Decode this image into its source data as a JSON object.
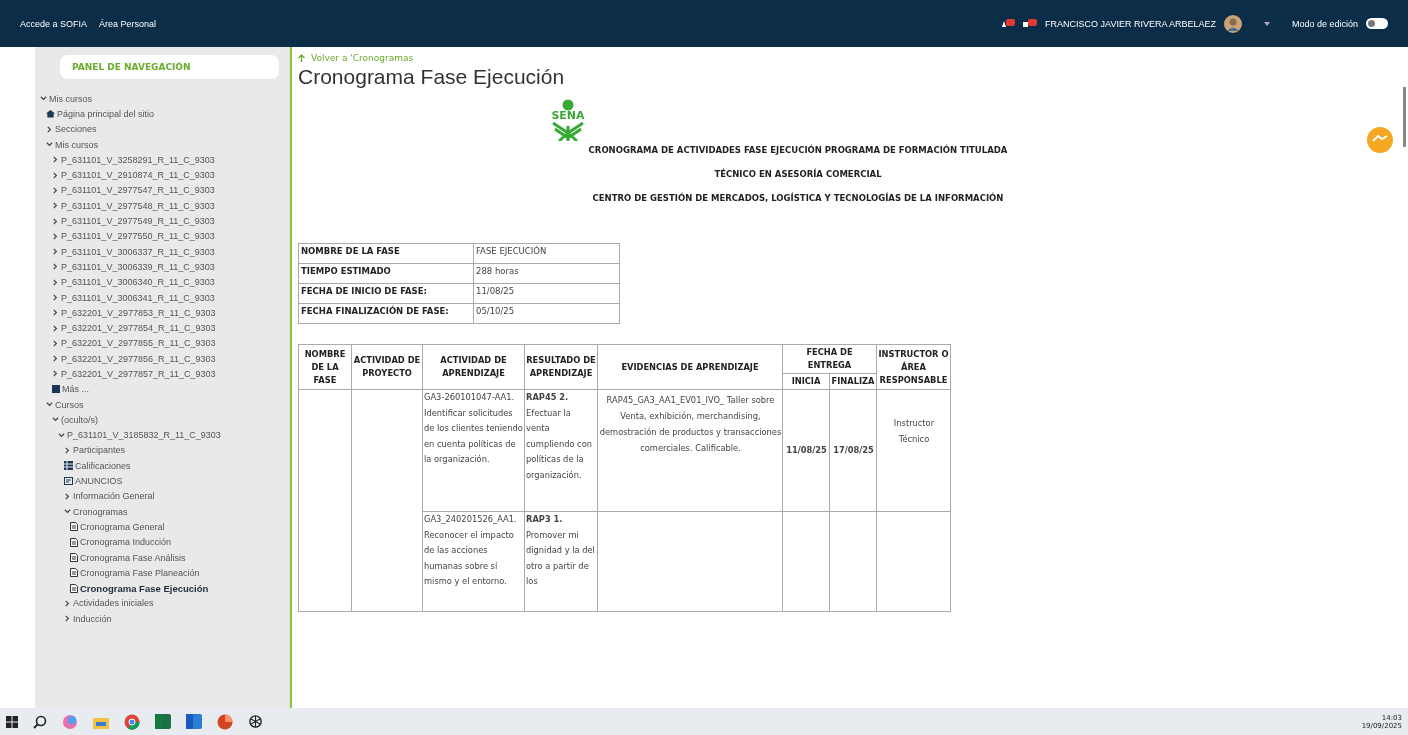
{
  "header": {
    "links": [
      "Accede a SOFIA",
      "Área Personal"
    ],
    "user_name": "FRANCISCO JAVIER RIVERA ARBELAEZ",
    "edit_mode": {
      "label": "Modo de edición",
      "on": false
    }
  },
  "sidebar": {
    "title": "PANEL DE NAVEGACIÓN",
    "items": [
      {
        "kind": "branch",
        "label": "Mis cursos",
        "expanded": true,
        "selected": false,
        "children": [
          {
            "kind": "home",
            "label": "Página principal del sitio",
            "selected": false
          },
          {
            "kind": "branch",
            "label": "Secciones",
            "expanded": false,
            "selected": false
          },
          {
            "kind": "branch",
            "label": "Mis cursos",
            "expanded": true,
            "selected": false,
            "children": [
              {
                "kind": "branch",
                "label": "P_631101_V_3258291_R_11_C_9303",
                "expanded": false,
                "selected": false
              },
              {
                "kind": "branch",
                "label": "P_631101_V_2910874_R_11_C_9303",
                "expanded": false,
                "selected": false
              },
              {
                "kind": "branch",
                "label": "P_631101_V_2977547_R_11_C_9303",
                "expanded": false,
                "selected": false
              },
              {
                "kind": "branch",
                "label": "P_631101_V_2977548_R_11_C_9303",
                "expanded": false,
                "selected": false
              },
              {
                "kind": "branch",
                "label": "P_631101_V_2977549_R_11_C_9303",
                "expanded": false,
                "selected": false
              },
              {
                "kind": "branch",
                "label": "P_631101_V_2977550_R_11_C_9303",
                "expanded": false,
                "selected": false
              },
              {
                "kind": "branch",
                "label": "P_631101_V_3006337_R_11_C_9303",
                "expanded": false,
                "selected": false
              },
              {
                "kind": "branch",
                "label": "P_631101_V_3006339_R_11_C_9303",
                "expanded": false,
                "selected": false
              },
              {
                "kind": "branch",
                "label": "P_631101_V_3006340_R_11_C_9303",
                "expanded": false,
                "selected": false
              },
              {
                "kind": "branch",
                "label": "P_631101_V_3006341_R_11_C_9303",
                "expanded": false,
                "selected": false
              },
              {
                "kind": "branch",
                "label": "P_632201_V_2977853_R_11_C_9303",
                "expanded": false,
                "selected": false
              },
              {
                "kind": "branch",
                "label": "P_632201_V_2977854_R_11_C_9303",
                "expanded": false,
                "selected": false
              },
              {
                "kind": "branch",
                "label": "P_632201_V_2977855_R_11_C_9303",
                "expanded": false,
                "selected": false
              },
              {
                "kind": "branch",
                "label": "P_632201_V_2977856_R_11_C_9303",
                "expanded": false,
                "selected": false
              },
              {
                "kind": "branch",
                "label": "P_632201_V_2977857_R_11_C_9303",
                "expanded": false,
                "selected": false
              },
              {
                "kind": "more",
                "label": "Más ...",
                "selected": false
              }
            ]
          },
          {
            "kind": "branch",
            "label": "Cursos",
            "expanded": true,
            "selected": false,
            "children": [
              {
                "kind": "branch",
                "label": "(oculto/s)",
                "expanded": true,
                "selected": false,
                "children": [
                  {
                    "kind": "branch",
                    "label": "P_631101_V_3185832_R_11_C_9303",
                    "expanded": true,
                    "selected": false,
                    "children": [
                      {
                        "kind": "branch",
                        "label": "Participantes",
                        "expanded": false,
                        "selected": false
                      },
                      {
                        "kind": "grades",
                        "label": "Calificaciones",
                        "selected": false
                      },
                      {
                        "kind": "forum",
                        "label": "ANUNCIOS",
                        "selected": false
                      },
                      {
                        "kind": "branch",
                        "label": "Información General",
                        "expanded": false,
                        "selected": false
                      },
                      {
                        "kind": "branch",
                        "label": "Cronogramas",
                        "expanded": true,
                        "selected": false,
                        "children": [
                          {
                            "kind": "file",
                            "label": "Cronograma General",
                            "selected": false
                          },
                          {
                            "kind": "file",
                            "label": "Cronograma Inducción",
                            "selected": false
                          },
                          {
                            "kind": "file",
                            "label": "Cronograma Fase Análisis",
                            "selected": false
                          },
                          {
                            "kind": "file",
                            "label": "Cronograma Fase Planeación",
                            "selected": false
                          },
                          {
                            "kind": "file",
                            "label": "Cronograma Fase Ejecución",
                            "selected": true
                          }
                        ]
                      },
                      {
                        "kind": "branch",
                        "label": "Actividades iniciales",
                        "expanded": false,
                        "selected": false
                      },
                      {
                        "kind": "branch",
                        "label": "Inducción",
                        "expanded": false,
                        "selected": false
                      }
                    ]
                  }
                ]
              }
            ]
          }
        ]
      }
    ]
  },
  "page": {
    "back_link": "Volver a 'Cronogramas",
    "title": "Cronograma Fase Ejecución",
    "logo_text": "SENA",
    "headings": [
      "CRONOGRAMA  DE ACTIVIDADES FASE EJECUCIÓN PROGRAMA DE FORMACIÓN TITULADA",
      "TÉCNICO EN ASESORÍA COMERCIAL",
      "CENTRO DE GESTIÓN DE MERCADOS, LOGÍSTICA Y TECNOLOGÍAS DE LA INFORMACIÓN"
    ],
    "info_table": [
      {
        "label": "NOMBRE DE LA FASE",
        "value": "FASE EJECUCIÓN"
      },
      {
        "label": "TIEMPO ESTIMADO",
        "value": "288 horas"
      },
      {
        "label": "FECHA DE INICIO DE FASE:",
        "value": "11/08/25"
      },
      {
        "label": "FECHA FINALIZACIÓN DE FASE:",
        "value": "05/10/25"
      }
    ],
    "table": {
      "columns": [
        "NOMBRE DE LA FASE",
        "ACTIVIDAD DE PROYECTO",
        "ACTIVIDAD DE APRENDIZAJE",
        "RESULTADO DE APRENDIZAJE",
        "EVIDENCIAS DE APRENDIZAJE",
        "FECHA DE ENTREGA",
        "INSTRUCTOR O ÁREA RESPONSABLE"
      ],
      "date_columns": [
        "INICIA",
        "FINALIZA"
      ],
      "rows": [
        {
          "learning_activity": "GA3-260101047-AA1. Identificar solicitudes de los clientes teniendo en cuenta políticas de la organización.",
          "result_code": "RAP45 2.",
          "result_text": "Efectuar la venta cumpliendo con políticas de la organización.",
          "evidence": "RAP45_GA3_AA1_EV01_IVO_ Taller sobre Venta, exhibición, merchandising, demostración de productos y transacciones comerciales. Calificable.",
          "start": "11/08/25",
          "end": "17/08/25",
          "instructor": "Instructor Técnico"
        },
        {
          "learning_activity": "GA3_240201526_AA1. Reconocer el impacto de las acciones humanas sobre sí mismo y  el entorno.",
          "result_code": "RAP3 1.",
          "result_text": "Promover mi dignidad y la del otro a partir de los"
        }
      ]
    }
  },
  "taskbar": {
    "time": "14:03",
    "date": "19/09/2025"
  }
}
